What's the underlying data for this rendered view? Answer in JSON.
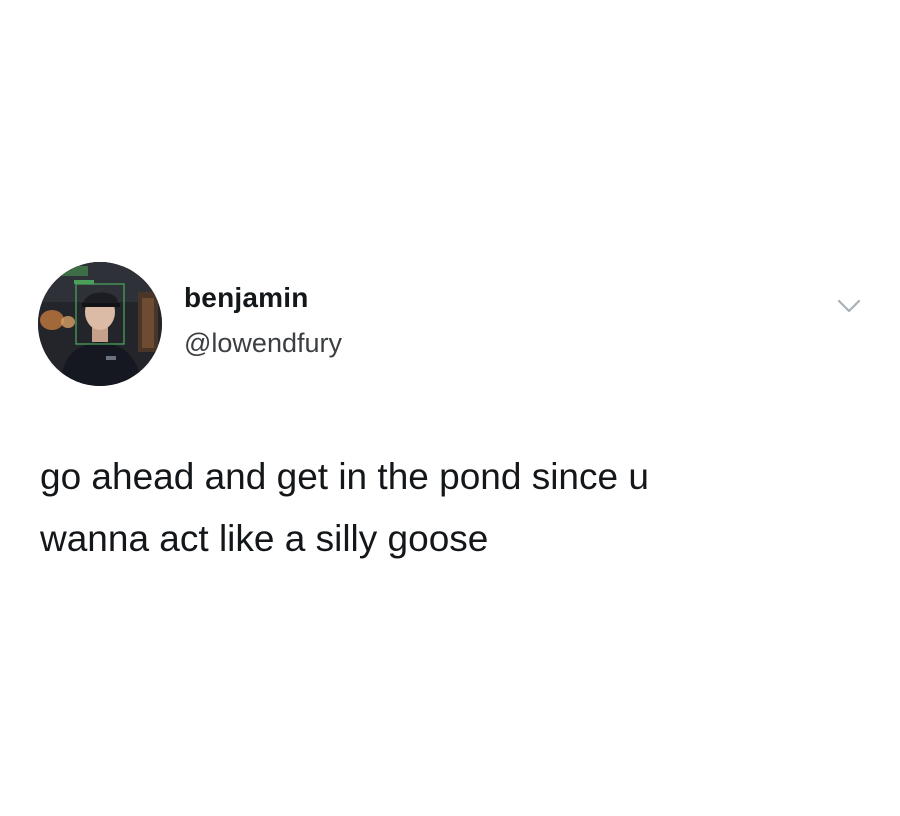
{
  "tweet": {
    "display_name": "benjamin",
    "handle": "@lowendfury",
    "text": "go ahead and get in the pond since u\nwanna act like a silly goose",
    "avatar_icon": "profile-photo",
    "menu_icon": "chevron-down-icon"
  },
  "colors": {
    "background": "#ffffff",
    "text": "#14171a",
    "secondary_text": "#3c3f42",
    "chevron": "#a8b1b8"
  }
}
